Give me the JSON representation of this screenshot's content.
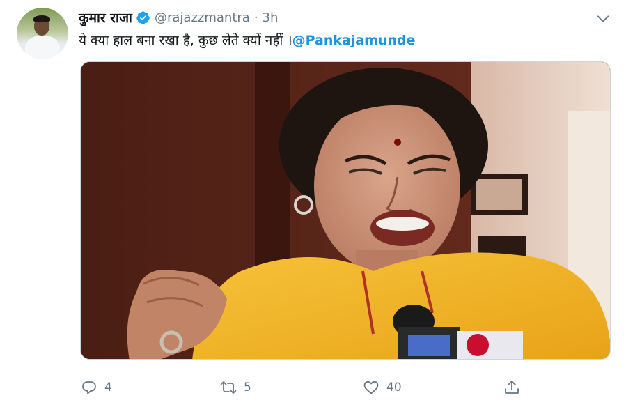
{
  "tweet": {
    "author_name": "कुमार राजा",
    "handle": "@rajazzmantra",
    "separator": "·",
    "time": "3h",
    "text_body": "ये क्या हाल बना रखा है, कुछ लेते क्यों नहीं ।",
    "mention": "@Pankajamunde"
  },
  "actions": {
    "reply_count": "4",
    "retweet_count": "5",
    "like_count": "40"
  },
  "icons": {
    "verified": "verified-badge-icon",
    "caret": "chevron-down-icon",
    "reply": "reply-icon",
    "retweet": "retweet-icon",
    "like": "heart-icon",
    "share": "share-icon"
  },
  "colors": {
    "accent": "#1b95e0",
    "verified": "#1da1f2",
    "secondary_text": "#657786"
  }
}
